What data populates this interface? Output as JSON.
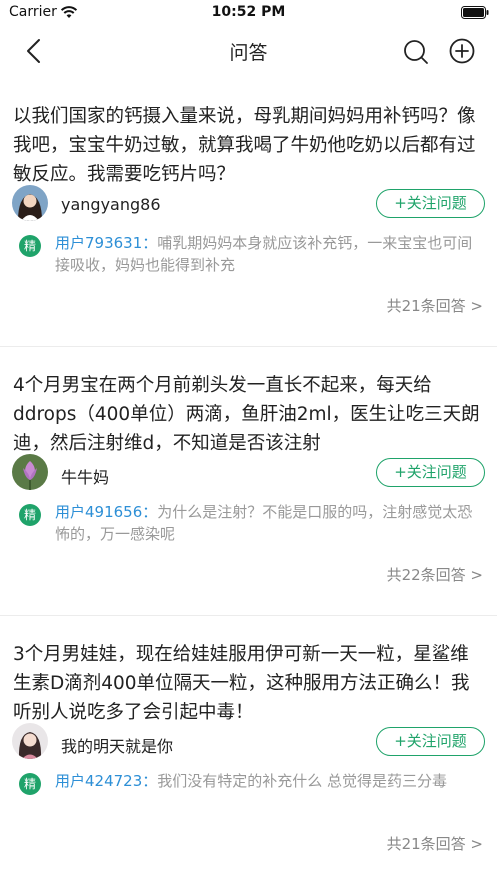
{
  "status_bar": {
    "carrier": "Carrier",
    "time": "10:52 PM",
    "wifi_icon": "wifi-icon",
    "battery_icon": "battery-icon"
  },
  "nav": {
    "title": "问答",
    "back_icon": "chevron-left-icon",
    "search_icon": "search-icon",
    "add_icon": "plus-circle-icon"
  },
  "colors": {
    "accent_green": "#1fa36a",
    "link_blue": "#2d8fd6",
    "muted_text": "#999999",
    "divider": "#ececec"
  },
  "questions": [
    {
      "question": "以我们国家的钙摄入量来说，母乳期间妈妈用补钙吗？像我吧，宝宝牛奶过敏，就算我喝了牛奶他吃奶以后都有过敏反应。我需要吃钙片吗？",
      "username": "yangyang86",
      "follow_label": "+关注问题",
      "badge": "精",
      "answer_user": "用户793631：",
      "answer_text": "哺乳期妈妈本身就应该补充钙，一来宝宝也可间接吸收，妈妈也能得到补充",
      "answer_count": "共21条回答 >"
    },
    {
      "question": "4个月男宝在两个月前剃头发一直长不起来，每天给ddrops（400单位）两滴，鱼肝油2ml，医生让吃三天朗迪，然后注射维d，不知道是否该注射",
      "username": "牛牛妈",
      "follow_label": "+关注问题",
      "badge": "精",
      "answer_user": "用户491656：",
      "answer_text": "为什么是注射？不能是口服的吗，注射感觉太恐怖的，万一感染呢",
      "answer_count": "共22条回答 >"
    },
    {
      "question": "3个月男娃娃，现在给娃娃服用伊可新一天一粒，星鲨维生素D滴剂400单位隔天一粒，这种服用方法正确么！我听别人说吃多了会引起中毒！",
      "username": "我的明天就是你",
      "follow_label": "+关注问题",
      "badge": "精",
      "answer_user": "用户424723：",
      "answer_text": "我们没有特定的补充什么 总觉得是药三分毒",
      "answer_count": "共21条回答 >"
    }
  ]
}
